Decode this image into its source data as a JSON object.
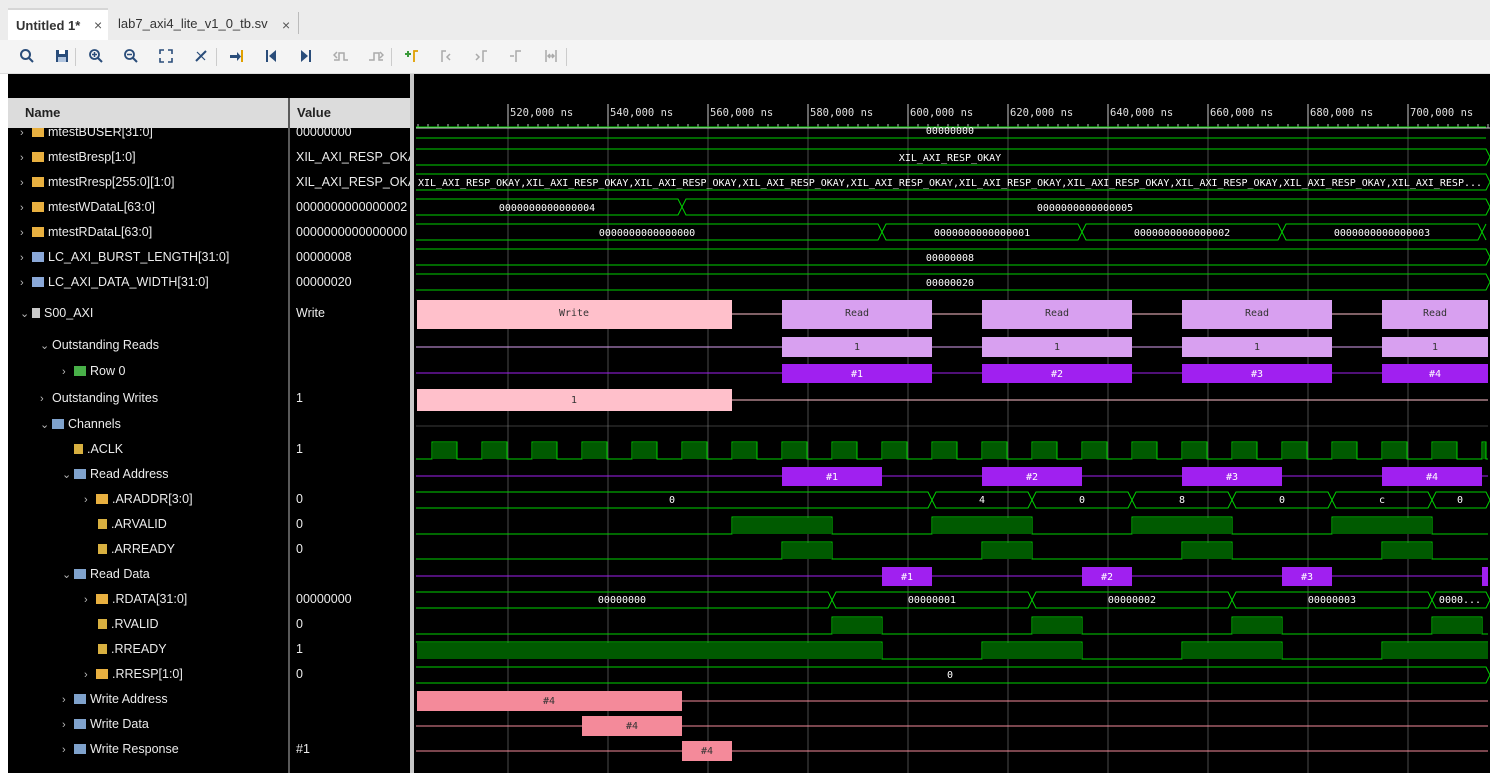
{
  "tabs": [
    {
      "label": "Untitled 1*",
      "active": true
    },
    {
      "label": "lab7_axi4_lite_v1_0_tb.sv",
      "active": false
    }
  ],
  "toolbar_icons": [
    "search-icon",
    "save-icon",
    "zoom-in-icon",
    "zoom-out-icon",
    "zoom-fit-icon",
    "cursor-icon",
    "go-to-cursor-icon",
    "go-to-start-icon",
    "go-to-end-icon",
    "previous-transition-icon",
    "next-transition-icon",
    "add-marker-icon",
    "previous-marker-icon",
    "next-marker-icon",
    "swap-cursors-icon",
    "fit-cursors-icon"
  ],
  "columns": {
    "name": "Name",
    "value": "Value"
  },
  "rows": [
    {
      "name": "mtestBUSER[31:0]",
      "value": "00000000"
    },
    {
      "name": "mtestBresp[1:0]",
      "value": "XIL_AXI_RESP_OKAY"
    },
    {
      "name": "mtestRresp[255:0][1:0]",
      "value": "XIL_AXI_RESP_OKAY"
    },
    {
      "name": "mtestWDataL[63:0]",
      "value": "0000000000000002"
    },
    {
      "name": "mtestRDataL[63:0]",
      "value": "0000000000000000"
    },
    {
      "name": "LC_AXI_BURST_LENGTH[31:0]",
      "value": "00000008"
    },
    {
      "name": "LC_AXI_DATA_WIDTH[31:0]",
      "value": "00000020"
    },
    {
      "name": "S00_AXI",
      "value": "Write"
    },
    {
      "name": "Outstanding Reads",
      "value": ""
    },
    {
      "name": "Row 0",
      "value": ""
    },
    {
      "name": "Outstanding Writes",
      "value": "1"
    },
    {
      "name": "Channels",
      "value": ""
    },
    {
      "name": ".ACLK",
      "value": "1"
    },
    {
      "name": "Read Address",
      "value": ""
    },
    {
      "name": ".ARADDR[3:0]",
      "value": "0"
    },
    {
      "name": ".ARVALID",
      "value": "0"
    },
    {
      "name": ".ARREADY",
      "value": "0"
    },
    {
      "name": "Read Data",
      "value": ""
    },
    {
      "name": ".RDATA[31:0]",
      "value": "00000000"
    },
    {
      "name": ".RVALID",
      "value": "0"
    },
    {
      "name": ".RREADY",
      "value": "1"
    },
    {
      "name": ".RRESP[1:0]",
      "value": "0"
    },
    {
      "name": "Write Address",
      "value": ""
    },
    {
      "name": "Write Data",
      "value": ""
    },
    {
      "name": "Write Response",
      "value": "#1"
    }
  ],
  "timeline": {
    "ticks": [
      "520,000 ns",
      "540,000 ns",
      "560,000 ns",
      "580,000 ns",
      "600,000 ns",
      "620,000 ns",
      "640,000 ns",
      "660,000 ns",
      "680,000 ns",
      "700,000 ns"
    ]
  },
  "waves": {
    "buser": "00000000",
    "bresp": "XIL_AXI_RESP_OKAY",
    "rresp": "XIL_AXI_RESP_OKAY,XIL_AXI_RESP_OKAY,XIL_AXI_RESP_OKAY,XIL_AXI_RESP_OKAY,XIL_AXI_RESP_OKAY,XIL_AXI_RESP_OKAY,XIL_AXI_RESP_OKAY,XIL_AXI_RESP_OKAY,XIL_AXI_RESP_OKAY,XIL_AXI_RESP...",
    "wdata": [
      "0000000000000004",
      "0000000000000005"
    ],
    "rdatal": [
      "0000000000000000",
      "0000000000000001",
      "0000000000000002",
      "0000000000000003"
    ],
    "burst_len": "00000008",
    "data_width": "00000020",
    "s00": [
      "Write",
      "Read",
      "Read",
      "Read",
      "Read"
    ],
    "outstanding_reads": [
      "1",
      "1",
      "1",
      "1"
    ],
    "row0": [
      "#1",
      "#2",
      "#3",
      "#4"
    ],
    "outstanding_writes": "1",
    "read_address": [
      "#1",
      "#2",
      "#3",
      "#4"
    ],
    "araddr": [
      "0",
      "4",
      "0",
      "8",
      "0",
      "c",
      "0"
    ],
    "read_data": [
      "#1",
      "#2",
      "#3"
    ],
    "rdata": [
      "00000000",
      "00000001",
      "00000002",
      "00000003",
      "0000..."
    ],
    "rresp_val": "0",
    "write_address": "#4",
    "write_data": "#4",
    "write_response": "#4"
  },
  "colors": {
    "green": "#00c800",
    "pink": "#ffc0cb",
    "lilac": "#d8a0f0",
    "purple": "#a020f0",
    "salmon": "#f48a9a"
  }
}
